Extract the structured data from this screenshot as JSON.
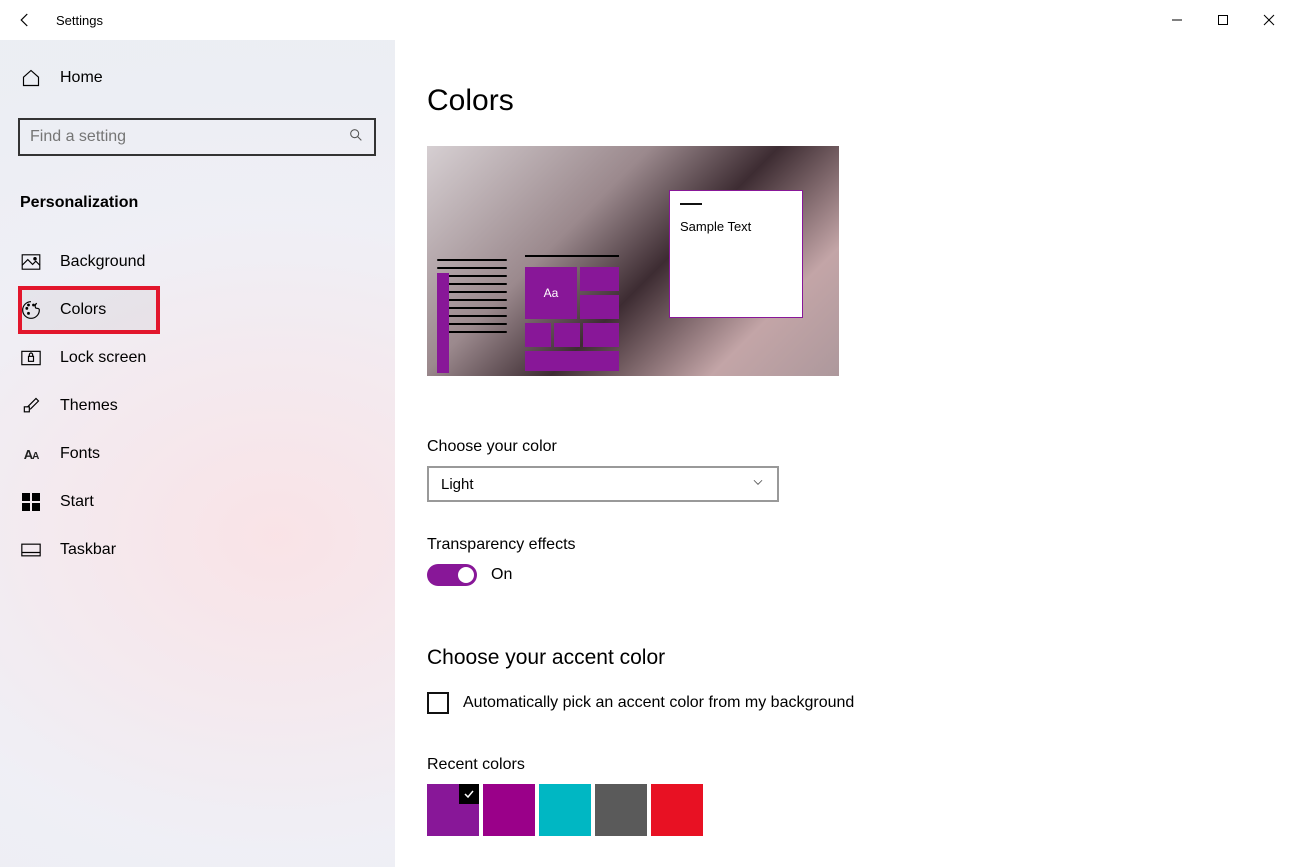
{
  "window": {
    "title": "Settings"
  },
  "sidebar": {
    "home": "Home",
    "search_placeholder": "Find a setting",
    "category": "Personalization",
    "items": [
      {
        "label": "Background"
      },
      {
        "label": "Colors"
      },
      {
        "label": "Lock screen"
      },
      {
        "label": "Themes"
      },
      {
        "label": "Fonts"
      },
      {
        "label": "Start"
      },
      {
        "label": "Taskbar"
      }
    ]
  },
  "page": {
    "title": "Colors",
    "preview": {
      "sample_text": "Sample Text",
      "tile_label": "Aa",
      "accent": "#881798"
    },
    "choose_color_label": "Choose your color",
    "choose_color_value": "Light",
    "transparency_label": "Transparency effects",
    "transparency_state": "On",
    "accent_heading": "Choose your accent color",
    "auto_accent_label": "Automatically pick an accent color from my background",
    "auto_accent_checked": false,
    "recent_colors_label": "Recent colors",
    "recent_colors": [
      "#881798",
      "#9a0089",
      "#00b7c3",
      "#5a5a5a",
      "#e81123"
    ],
    "recent_selected_index": 0
  }
}
